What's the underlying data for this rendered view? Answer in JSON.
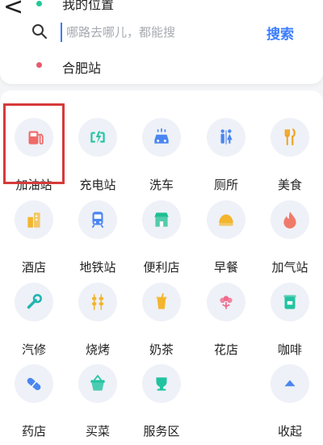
{
  "header": {
    "start_location": "我的位置",
    "search_placeholder": "哪路去哪儿，都能搜",
    "search_button": "搜索",
    "destination": "合肥站"
  },
  "colors": {
    "accent": "#3b7cff",
    "start_dot": "#20c997",
    "end_dot": "#e85a6b",
    "highlight": "#d63a3a"
  },
  "categories": [
    {
      "label": "加油站",
      "icon": "gas-station-icon",
      "color": "#f06a6a"
    },
    {
      "label": "充电站",
      "icon": "charging-icon",
      "color": "#22c3a0"
    },
    {
      "label": "洗车",
      "icon": "car-wash-icon",
      "color": "#4a86f0"
    },
    {
      "label": "厕所",
      "icon": "toilet-icon",
      "color": "#4a86f0"
    },
    {
      "label": "美食",
      "icon": "food-icon",
      "color": "#f0a21e"
    },
    {
      "label": "酒店",
      "icon": "hotel-icon",
      "color": "#f3b52c"
    },
    {
      "label": "地铁站",
      "icon": "subway-icon",
      "color": "#4a86f0"
    },
    {
      "label": "便利店",
      "icon": "store-icon",
      "color": "#1fbf93"
    },
    {
      "label": "早餐",
      "icon": "bun-icon",
      "color": "#f3b52c"
    },
    {
      "label": "加气站",
      "icon": "gas-flame-icon",
      "color": "#f07a6a"
    },
    {
      "label": "汽修",
      "icon": "wrench-icon",
      "color": "#22b5b0"
    },
    {
      "label": "烧烤",
      "icon": "skewer-icon",
      "color": "#f3b52c"
    },
    {
      "label": "奶茶",
      "icon": "milk-tea-icon",
      "color": "#f3b52c"
    },
    {
      "label": "花店",
      "icon": "flower-icon",
      "color": "#f06a8a"
    },
    {
      "label": "咖啡",
      "icon": "coffee-icon",
      "color": "#22c3a0"
    },
    {
      "label": "药店",
      "icon": "pill-icon",
      "color": "#4a86f0"
    },
    {
      "label": "买菜",
      "icon": "basket-icon",
      "color": "#22c3a0"
    },
    {
      "label": "服务区",
      "icon": "cup-icon",
      "color": "#22c3a0"
    },
    {
      "label": "",
      "icon": "",
      "color": ""
    },
    {
      "label": "收起",
      "icon": "collapse-triangle-icon",
      "color": "#4a86f0"
    }
  ]
}
